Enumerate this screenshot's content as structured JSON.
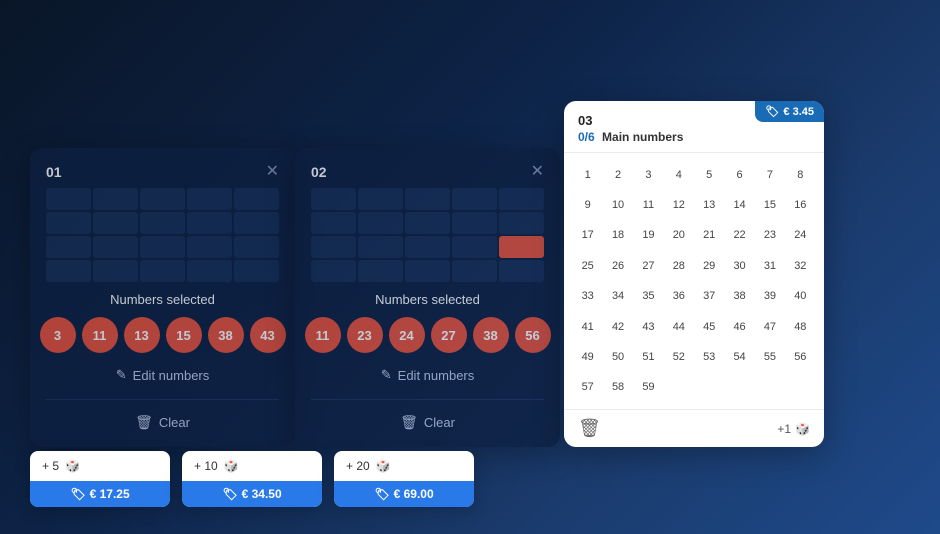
{
  "cards": [
    {
      "id": "01",
      "numbers": [
        3,
        11,
        13,
        15,
        38,
        43
      ],
      "edit_label": "Edit numbers",
      "clear_label": "Clear"
    },
    {
      "id": "02",
      "numbers": [
        11,
        23,
        24,
        27,
        38,
        56
      ],
      "edit_label": "Edit numbers",
      "clear_label": "Clear"
    }
  ],
  "picker": {
    "card_id": "03",
    "progress": "0/6",
    "section_label": "Main numbers",
    "price": "€ 3.45",
    "numbers": [
      1,
      2,
      3,
      4,
      5,
      6,
      7,
      8,
      9,
      10,
      11,
      12,
      13,
      14,
      15,
      16,
      17,
      18,
      19,
      20,
      21,
      22,
      23,
      24,
      25,
      26,
      27,
      28,
      29,
      30,
      31,
      32,
      33,
      34,
      35,
      36,
      37,
      38,
      39,
      40,
      41,
      42,
      43,
      44,
      45,
      46,
      47,
      48,
      49,
      50,
      51,
      52,
      53,
      54,
      55,
      56,
      57,
      58,
      59
    ]
  },
  "add_options": [
    {
      "label": "+ 5",
      "price": "€ 17.25"
    },
    {
      "label": "+ 10",
      "price": "€ 34.50"
    },
    {
      "label": "+ 20",
      "price": "€ 69.00"
    }
  ],
  "icons": {
    "close": "✕",
    "edit": "✎",
    "trash": "🗑",
    "tag": "🏷",
    "dice": "🎲"
  }
}
